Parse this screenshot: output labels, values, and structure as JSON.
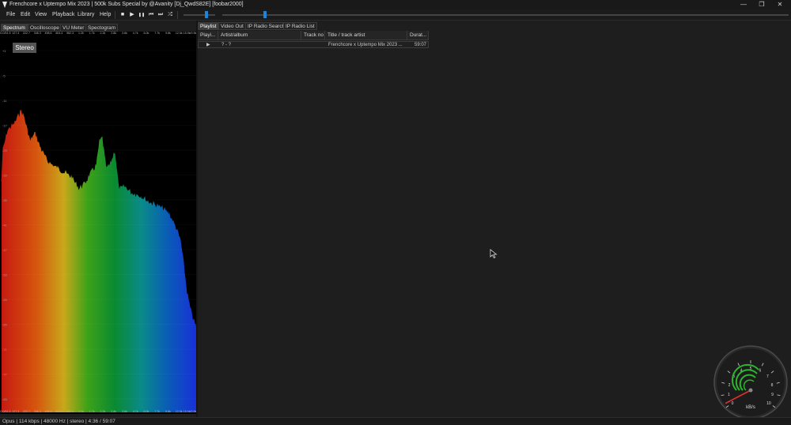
{
  "window": {
    "title": "Frenchcore x Uptempo Mix 2023  |  500k Subs Special by @Avanity [Dj_QwdS82E]  [foobar2000]",
    "minimize": "—",
    "maximize": "❐",
    "close": "✕"
  },
  "menu": [
    "File",
    "Edit",
    "View",
    "Playback",
    "Library",
    "Help"
  ],
  "toolbar": {
    "stop": "■",
    "play": "▶",
    "pause": "❚❚",
    "prev": "⏮",
    "next": "⏭",
    "random": "⤮"
  },
  "volume_fraction": 0.72,
  "seek_fraction": 0.075,
  "vis_tabs": [
    "Spectrum",
    "Oscilloscope",
    "VU Meter",
    "Spectogram"
  ],
  "spectrum": {
    "label": "Stereo",
    "freq_labels": [
      "20.0/51.5",
      "127.3",
      "222.7",
      "346.3",
      "498.6",
      "604.4",
      "962.3",
      "1.2k",
      "1.7k",
      "2.2k",
      "2.8k",
      "3.6k",
      "4.7k",
      "6.0k",
      "7.7k",
      "9.8k",
      "12.5k",
      "15.9k/0.9k"
    ],
    "db_labels": [
      "+1",
      "-5",
      "-11",
      "-17",
      "-23",
      "-29",
      "-35",
      "-41",
      "-47",
      "-53",
      "-59",
      "-65",
      "-71",
      "-77",
      "-83"
    ]
  },
  "playlist_tabs": [
    "Playlist",
    "Video Out",
    "IP Radio Search",
    "IP Radio List"
  ],
  "columns": [
    "Playi...",
    "Artist/album",
    "Track no",
    "Title / track artist",
    "Durat..."
  ],
  "rows": [
    {
      "playing": "▶",
      "artist_album": "? - ?",
      "track_no": "",
      "title": "Frenchcore x Uptempo Mix 2023 ...",
      "duration": "59:07"
    }
  ],
  "gauge": {
    "ticks": [
      "0",
      "1",
      "2",
      "3",
      "4",
      "5",
      "6",
      "7",
      "8",
      "9",
      "10"
    ],
    "unit": "kB/s",
    "value_kbps": 0.3
  },
  "status": "Opus | 114 kbps | 48000 Hz | stereo | 4:36 / 59:07"
}
